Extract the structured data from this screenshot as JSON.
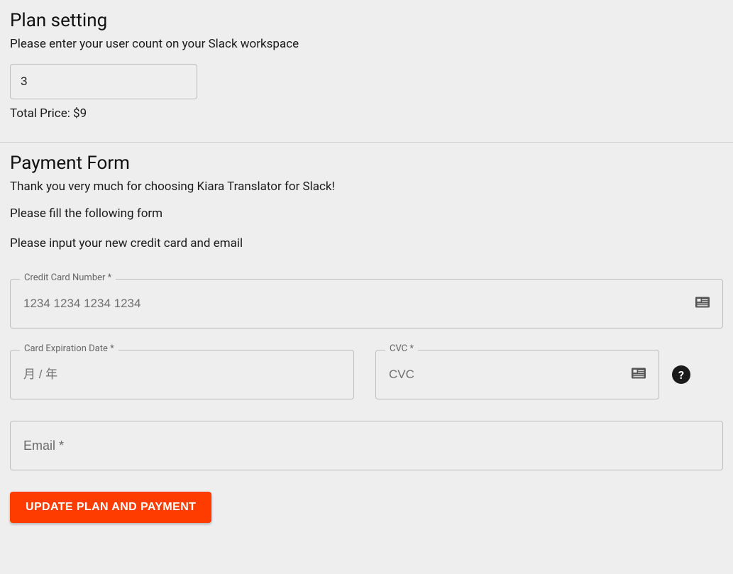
{
  "plan": {
    "title": "Plan setting",
    "subtitle": "Please enter your user count on your Slack workspace",
    "user_count_value": "3",
    "total_price_text": "Total Price: $9"
  },
  "payment": {
    "title": "Payment Form",
    "thank_you": "Thank you very much for choosing Kiara Translator for Slack!",
    "fill_form": "Please fill the following form",
    "input_new": "Please input your new credit card and email",
    "fields": {
      "card_number": {
        "label": "Credit Card Number *",
        "placeholder": "1234 1234 1234 1234"
      },
      "expiration": {
        "label": "Card Expiration Date *",
        "placeholder": "月 / 年"
      },
      "cvc": {
        "label": "CVC *",
        "placeholder": "CVC"
      },
      "email": {
        "placeholder": "Email *"
      }
    },
    "submit_label": "UPDATE PLAN AND PAYMENT",
    "help_tooltip": "?"
  }
}
